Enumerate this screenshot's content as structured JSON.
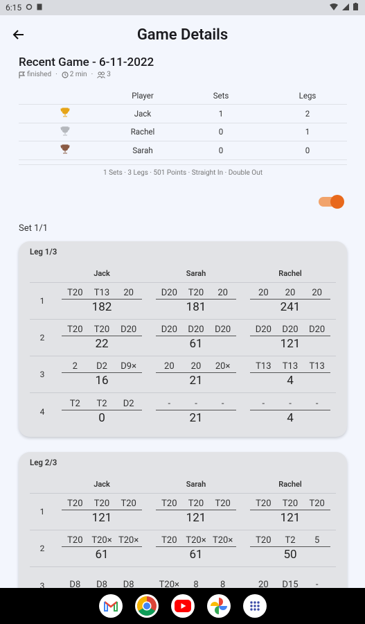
{
  "status": {
    "time": "6:15"
  },
  "appbar": {
    "title": "Game Details"
  },
  "game": {
    "title": "Recent Game - 6-11-2022",
    "meta": {
      "state": "finished",
      "duration": "2 min",
      "players": "3"
    }
  },
  "summary": {
    "headers": [
      "",
      "Player",
      "Sets",
      "Legs"
    ],
    "rows": [
      {
        "trophy": "gold",
        "player": "Jack",
        "sets": "1",
        "legs": "2"
      },
      {
        "trophy": "silver",
        "player": "Rachel",
        "sets": "0",
        "legs": "1"
      },
      {
        "trophy": "bronze",
        "player": "Sarah",
        "sets": "0",
        "legs": "0"
      }
    ],
    "note": "1 Sets · 3 Legs · 501 Points · Straight In · Double Out"
  },
  "set_label": "Set 1/1",
  "legs": [
    {
      "title": "Leg 1/3",
      "players": [
        "Jack",
        "Sarah",
        "Rachel"
      ],
      "rounds": [
        {
          "n": "1",
          "cells": [
            {
              "d": [
                "T20",
                "T13",
                "20"
              ],
              "r": "182"
            },
            {
              "d": [
                "D20",
                "T20",
                "20"
              ],
              "r": "181"
            },
            {
              "d": [
                "20",
                "20",
                "20"
              ],
              "r": "241"
            }
          ]
        },
        {
          "n": "2",
          "cells": [
            {
              "d": [
                "T20",
                "T20",
                "D20"
              ],
              "r": "22"
            },
            {
              "d": [
                "D20",
                "D20",
                "D20"
              ],
              "r": "61"
            },
            {
              "d": [
                "D20",
                "D20",
                "D20"
              ],
              "r": "121"
            }
          ]
        },
        {
          "n": "3",
          "cells": [
            {
              "d": [
                "2",
                "D2",
                "D9×"
              ],
              "r": "16"
            },
            {
              "d": [
                "20",
                "20",
                "20×"
              ],
              "r": "21"
            },
            {
              "d": [
                "T13",
                "T13",
                "T13"
              ],
              "r": "4"
            }
          ]
        },
        {
          "n": "4",
          "cells": [
            {
              "d": [
                "T2",
                "T2",
                "D2"
              ],
              "r": "0"
            },
            {
              "d": [
                "-",
                "-",
                "-"
              ],
              "r": "21"
            },
            {
              "d": [
                "-",
                "-",
                "-"
              ],
              "r": "4"
            }
          ]
        }
      ]
    },
    {
      "title": "Leg 2/3",
      "players": [
        "Jack",
        "Sarah",
        "Rachel"
      ],
      "rounds": [
        {
          "n": "1",
          "cells": [
            {
              "d": [
                "T20",
                "T20",
                "T20"
              ],
              "r": "121"
            },
            {
              "d": [
                "T20",
                "T20",
                "T20"
              ],
              "r": "121"
            },
            {
              "d": [
                "T20",
                "T20",
                "T20"
              ],
              "r": "121"
            }
          ]
        },
        {
          "n": "2",
          "cells": [
            {
              "d": [
                "T20",
                "T20×",
                "T20×"
              ],
              "r": "61"
            },
            {
              "d": [
                "T20",
                "T20×",
                "T20×"
              ],
              "r": "61"
            },
            {
              "d": [
                "T20",
                "T2",
                "5"
              ],
              "r": "50"
            }
          ]
        },
        {
          "n": "3",
          "cells": [
            {
              "d": [
                "D8",
                "D8",
                "D8"
              ],
              "r": ""
            },
            {
              "d": [
                "T20×",
                "8",
                "8"
              ],
              "r": ""
            },
            {
              "d": [
                "20",
                "D15",
                "-"
              ],
              "r": ""
            }
          ]
        }
      ]
    }
  ],
  "nav_apps": [
    "gmail-icon",
    "chrome-icon",
    "youtube-icon",
    "photos-icon",
    "apps-icon"
  ],
  "colors": {
    "accent": "#e8691c",
    "gold": "#e6a417",
    "silver": "#b5b8bd",
    "bronze": "#8a5a44"
  }
}
